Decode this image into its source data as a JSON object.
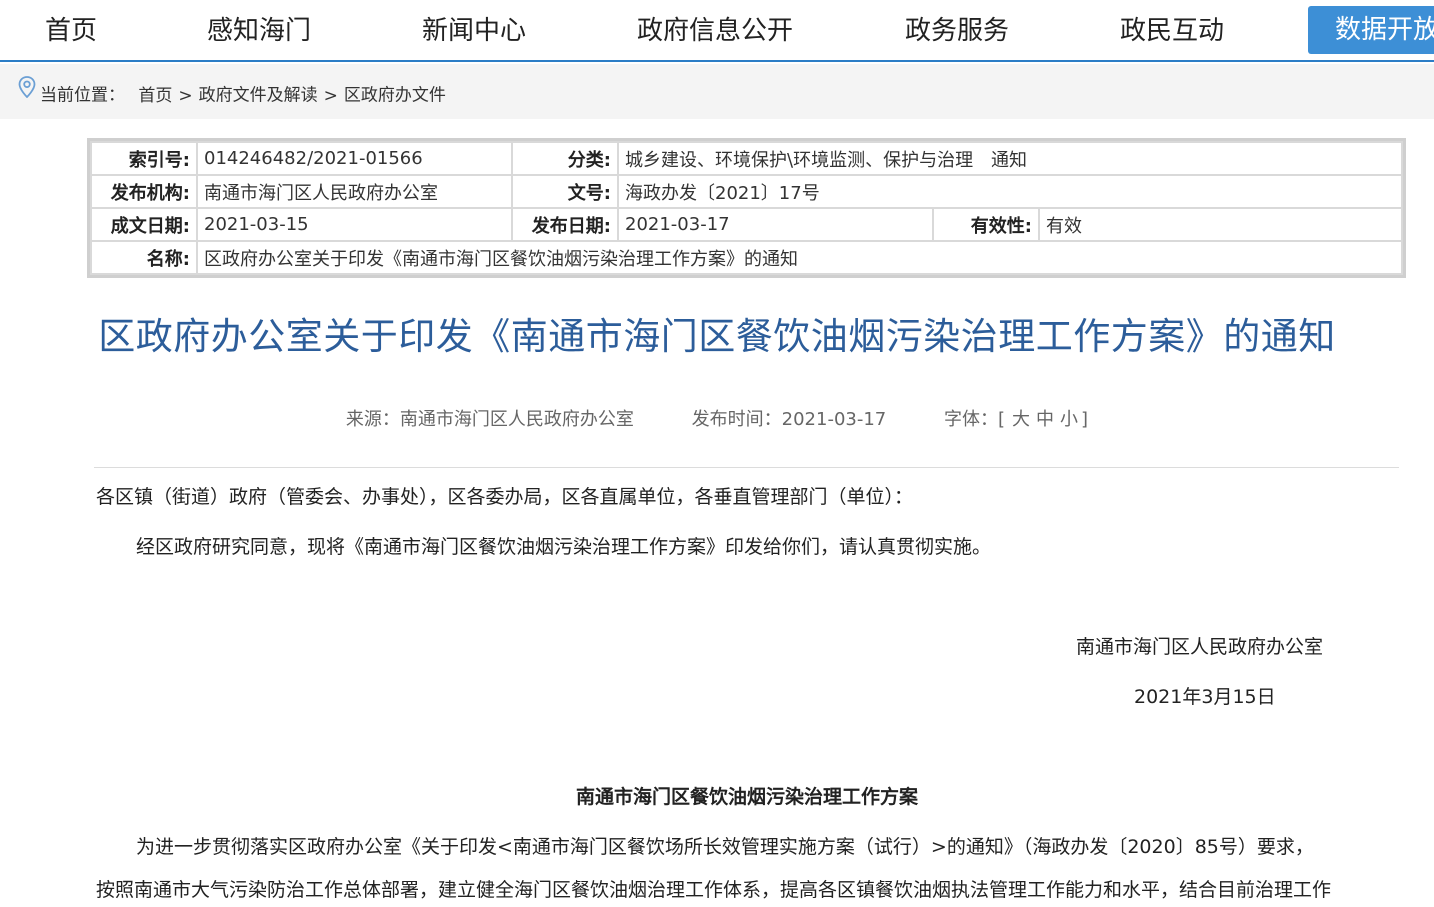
{
  "nav": {
    "items": [
      "首页",
      "感知海门",
      "新闻中心",
      "政府信息公开",
      "政务服务",
      "政民互动"
    ],
    "active_item": "数据开放"
  },
  "breadcrumb": {
    "prefix": "当前位置：",
    "items": [
      "首页",
      "政府文件及解读",
      "区政府办文件"
    ],
    "separator": ">"
  },
  "info": {
    "index_label": "索引号:",
    "index_value": "014246482/2021-01566",
    "category_label": "分类:",
    "category_value": "城乡建设、环境保护\\环境监测、保护与治理　通知",
    "publisher_label": "发布机构:",
    "publisher_value": "南通市海门区人民政府办公室",
    "docno_label": "文号:",
    "docno_value": "海政办发〔2021〕17号",
    "created_label": "成文日期:",
    "created_value": "2021-03-15",
    "published_label": "发布日期:",
    "published_value": "2021-03-17",
    "validity_label": "有效性:",
    "validity_value": "有效",
    "name_label": "名称:",
    "name_value": "区政府办公室关于印发《南通市海门区餐饮油烟污染治理工作方案》的通知"
  },
  "article": {
    "title": "区政府办公室关于印发《南通市海门区餐饮油烟污染治理工作方案》的通知",
    "source": "来源：南通市海门区人民政府办公室",
    "pubtime": "发布时间：2021-03-17",
    "font_label": "字体：[",
    "font_large": "大",
    "font_medium": "中",
    "font_small": "小",
    "font_end": "]",
    "salutation": "各区镇（街道）政府（管委会、办事处），区各委办局，区各直属单位，各垂直管理部门（单位）：",
    "body1": "经区政府研究同意，现将《南通市海门区餐饮油烟污染治理工作方案》印发给你们，请认真贯彻实施。",
    "signature": "南通市海门区人民政府办公室",
    "date": "2021年3月15日",
    "plan_title": "南通市海门区餐饮油烟污染治理工作方案",
    "plan_p1": "为进一步贯彻落实区政府办公室《关于印发<南通市海门区餐饮场所长效管理实施方案（试行）>的通知》（海政办发〔2020〕85号）要求，",
    "plan_p2": "按照南通市大气污染防治工作总体部署，建立健全海门区餐饮油烟治理工作体系，提高各区镇餐饮油烟执法管理工作能力和水平，结合目前治理工作"
  },
  "colors": {
    "accent": "#3d8fd6",
    "title": "#2c5d9a"
  }
}
